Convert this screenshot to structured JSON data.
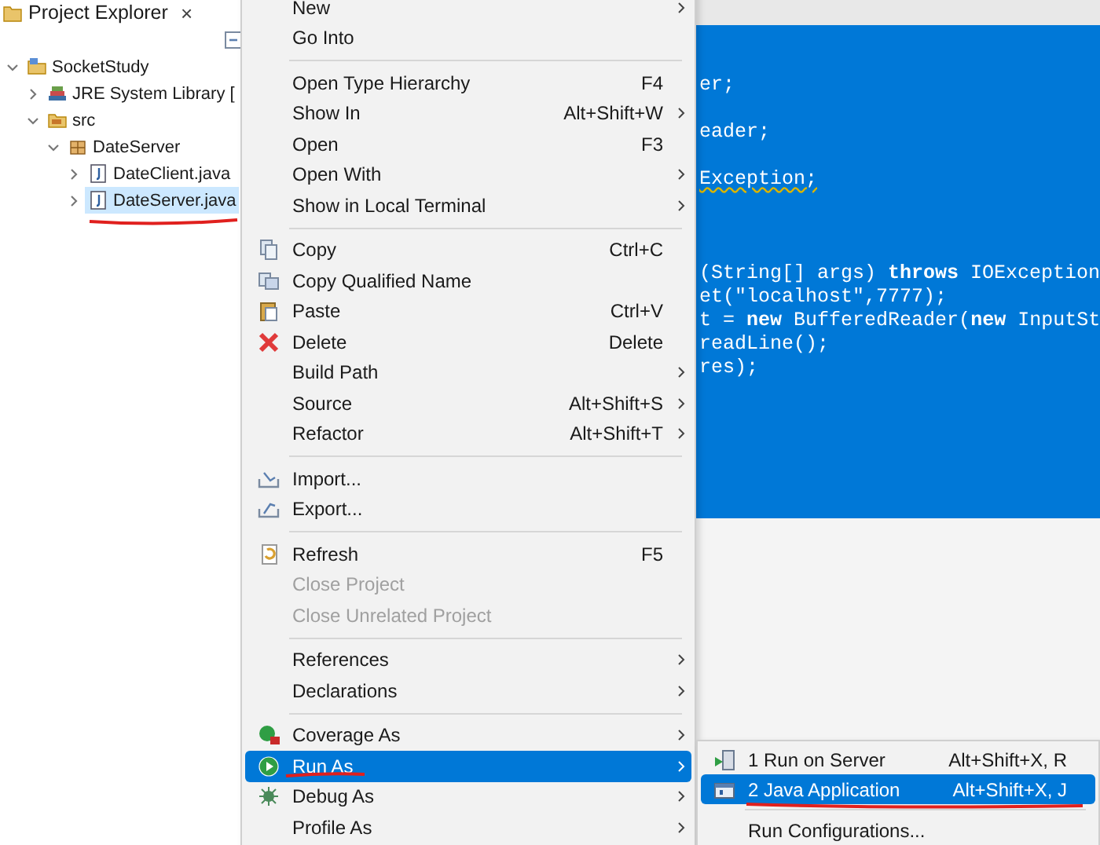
{
  "explorer": {
    "tab": {
      "title": "Project Explorer",
      "close": "×"
    },
    "tree": [
      {
        "label": "SocketStudy",
        "kind": "project",
        "expanded": true,
        "selected": false,
        "children": [
          {
            "label": "JRE System Library [",
            "kind": "library",
            "expanded": false,
            "selected": false
          },
          {
            "label": "src",
            "kind": "source-folder",
            "expanded": true,
            "selected": false,
            "children": [
              {
                "label": "DateServer",
                "kind": "package",
                "expanded": true,
                "selected": false,
                "children": [
                  {
                    "label": "DateClient.java",
                    "kind": "java-file",
                    "expanded": false,
                    "selected": false
                  },
                  {
                    "label": "DateServer.java",
                    "kind": "java-file",
                    "expanded": false,
                    "selected": true
                  }
                ]
              }
            ]
          }
        ]
      }
    ]
  },
  "editor": {
    "lines": [
      {
        "kind": "code",
        "text": "er;"
      },
      {
        "kind": "blank"
      },
      {
        "kind": "code",
        "text": "eader;"
      },
      {
        "kind": "blank"
      },
      {
        "kind": "code",
        "text": "Exception;",
        "warning": true
      },
      {
        "kind": "blank"
      },
      {
        "kind": "blank"
      },
      {
        "kind": "blank"
      },
      {
        "kind": "code",
        "text": "(String[] args) **throws** IOException"
      },
      {
        "kind": "code",
        "text": "et(\"localhost\",7777);"
      },
      {
        "kind": "code",
        "text": "t = **new** BufferedReader(**new** InputSt"
      },
      {
        "kind": "code",
        "text": "readLine();"
      },
      {
        "kind": "code",
        "text": "res);"
      }
    ]
  },
  "context_menu": {
    "items": [
      {
        "kind": "text",
        "label": "New",
        "submenu": true,
        "disabled": false,
        "selected": false
      },
      {
        "kind": "text",
        "label": "Go Into",
        "submenu": false,
        "disabled": false,
        "selected": false
      },
      {
        "kind": "separator"
      },
      {
        "kind": "text",
        "label": "Open Type Hierarchy",
        "shortcut": "F4",
        "submenu": false,
        "disabled": false,
        "selected": false
      },
      {
        "kind": "text",
        "label": "Show In",
        "shortcut": "Alt+Shift+W",
        "submenu": true,
        "disabled": false,
        "selected": false
      },
      {
        "kind": "text",
        "label": "Open",
        "shortcut": "F3",
        "submenu": false,
        "disabled": false,
        "selected": false
      },
      {
        "kind": "text",
        "label": "Open With",
        "submenu": true,
        "disabled": false,
        "selected": false
      },
      {
        "kind": "text",
        "label": "Show in Local Terminal",
        "submenu": true,
        "disabled": false,
        "selected": false
      },
      {
        "kind": "separator"
      },
      {
        "kind": "copy",
        "label": "Copy",
        "shortcut": "Ctrl+C",
        "submenu": false,
        "disabled": false,
        "selected": false
      },
      {
        "kind": "copy-name",
        "label": "Copy Qualified Name",
        "submenu": false,
        "disabled": false,
        "selected": false
      },
      {
        "kind": "paste",
        "label": "Paste",
        "shortcut": "Ctrl+V",
        "submenu": false,
        "disabled": false,
        "selected": false
      },
      {
        "kind": "delete",
        "label": "Delete",
        "shortcut": "Delete",
        "submenu": false,
        "disabled": false,
        "selected": false
      },
      {
        "kind": "text",
        "label": "Build Path",
        "submenu": true,
        "disabled": false,
        "selected": false
      },
      {
        "kind": "text",
        "label": "Source",
        "shortcut": "Alt+Shift+S",
        "submenu": true,
        "disabled": false,
        "selected": false
      },
      {
        "kind": "text",
        "label": "Refactor",
        "shortcut": "Alt+Shift+T",
        "submenu": true,
        "disabled": false,
        "selected": false
      },
      {
        "kind": "separator"
      },
      {
        "kind": "import",
        "label": "Import...",
        "submenu": false,
        "disabled": false,
        "selected": false
      },
      {
        "kind": "export",
        "label": "Export...",
        "submenu": false,
        "disabled": false,
        "selected": false
      },
      {
        "kind": "separator"
      },
      {
        "kind": "refresh",
        "label": "Refresh",
        "shortcut": "F5",
        "submenu": false,
        "disabled": false,
        "selected": false
      },
      {
        "kind": "text",
        "label": "Close Project",
        "submenu": false,
        "disabled": true,
        "selected": false
      },
      {
        "kind": "text",
        "label": "Close Unrelated Project",
        "submenu": false,
        "disabled": true,
        "selected": false
      },
      {
        "kind": "separator"
      },
      {
        "kind": "text",
        "label": "References",
        "submenu": true,
        "disabled": false,
        "selected": false
      },
      {
        "kind": "text",
        "label": "Declarations",
        "submenu": true,
        "disabled": false,
        "selected": false
      },
      {
        "kind": "separator"
      },
      {
        "kind": "coverage",
        "label": "Coverage As",
        "submenu": true,
        "disabled": false,
        "selected": false
      },
      {
        "kind": "run",
        "label": "Run As",
        "submenu": true,
        "disabled": false,
        "selected": true
      },
      {
        "kind": "debug",
        "label": "Debug As",
        "submenu": true,
        "disabled": false,
        "selected": false
      },
      {
        "kind": "text",
        "label": "Profile As",
        "submenu": true,
        "disabled": false,
        "selected": false
      }
    ]
  },
  "submenu": {
    "items": [
      {
        "kind": "server",
        "label": "1 Run on Server",
        "shortcut": "Alt+Shift+X, R",
        "submenu": false,
        "disabled": false,
        "selected": false
      },
      {
        "kind": "java-app",
        "label": "2 Java Application",
        "shortcut": "Alt+Shift+X, J",
        "submenu": false,
        "disabled": false,
        "selected": true
      },
      {
        "kind": "separator"
      },
      {
        "kind": "text",
        "label": "Run Configurations...",
        "submenu": false,
        "disabled": false,
        "selected": false
      }
    ]
  }
}
